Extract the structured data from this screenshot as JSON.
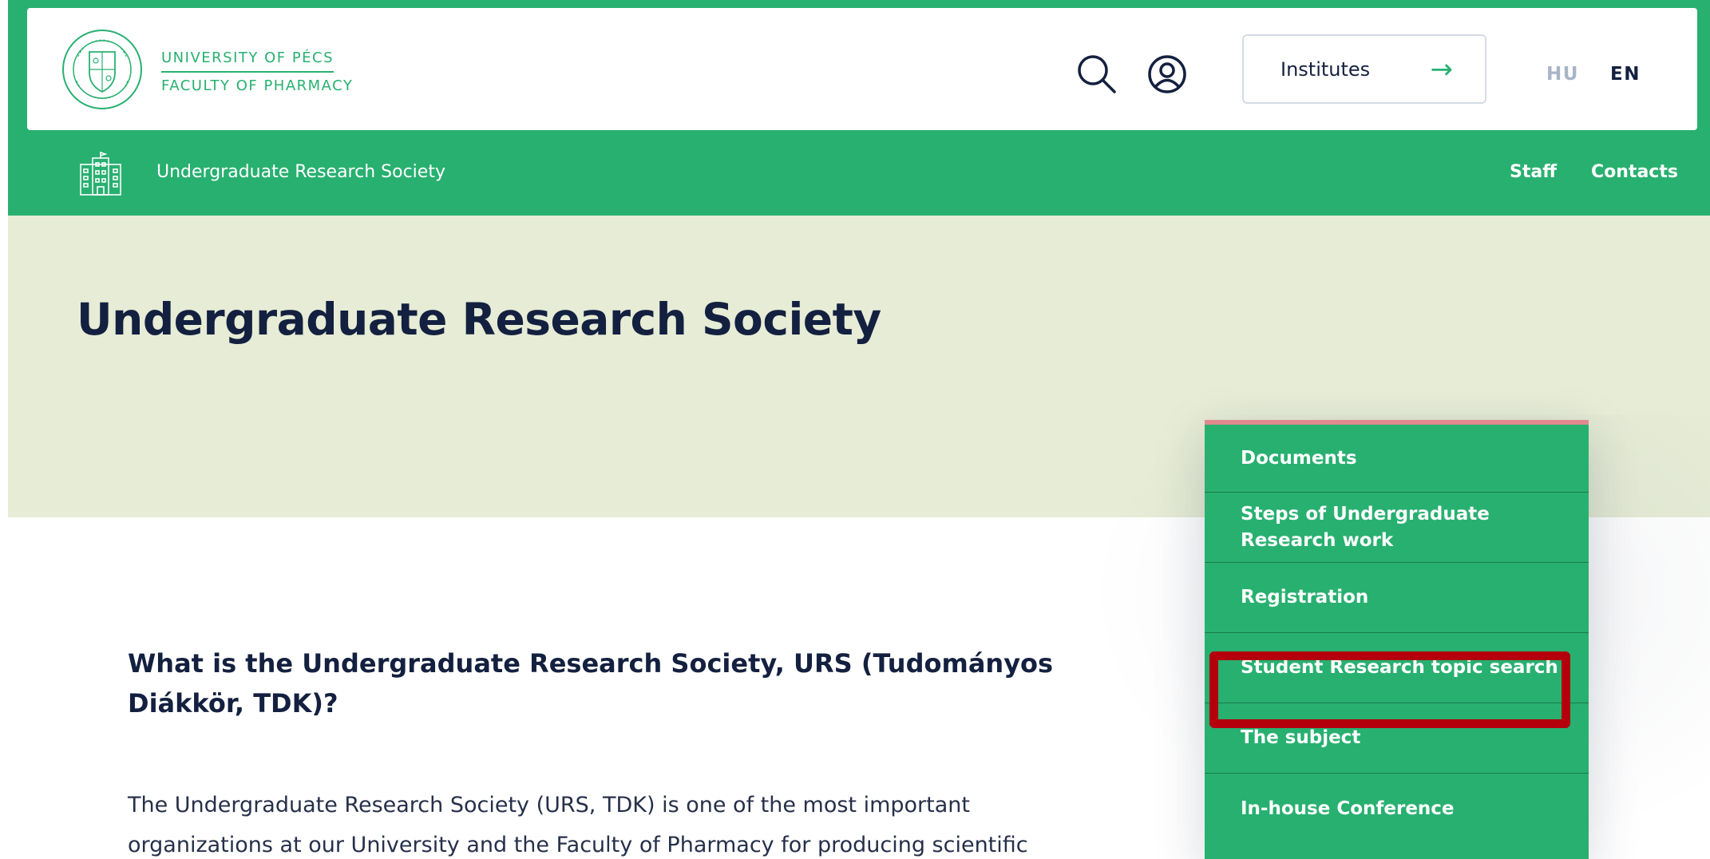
{
  "header": {
    "logo_line1": "UNIVERSITY OF PÉCS",
    "logo_line2": "FACULTY OF PHARMACY",
    "institutes_label": "Institutes",
    "lang_hu": "HU",
    "lang_en": "EN",
    "icons": [
      "university-seal-icon",
      "search-icon",
      "user-icon",
      "arrow-right-icon"
    ]
  },
  "navbar": {
    "title": "Undergraduate Research Society",
    "icon": "building-icon",
    "links": [
      "Staff",
      "Contacts"
    ]
  },
  "hero": {
    "title": "Undergraduate Research Society"
  },
  "main": {
    "heading": "What is the Undergraduate Research Society, URS (Tudományos Diákkör, TDK)?",
    "body": "The Undergraduate Research Society (URS, TDK) is one of the most important organizations at our University and the Faculty of Pharmacy for producing scientific"
  },
  "sidebar": {
    "items": [
      {
        "label": "Documents"
      },
      {
        "label": "Steps of Undergraduate Research work"
      },
      {
        "label": "Registration"
      },
      {
        "label": "Student Research topic search"
      },
      {
        "label": "The subject"
      },
      {
        "label": "In-house Conference"
      }
    ],
    "highlighted_index": 3
  },
  "colors": {
    "brand_green": "#28b070",
    "hero_bg": "#e6ecd6",
    "navy_text": "#14203f",
    "menu_top_accent": "#e08a8f",
    "highlight_red": "#b3000c",
    "lang_inactive": "#a8b4c8"
  }
}
